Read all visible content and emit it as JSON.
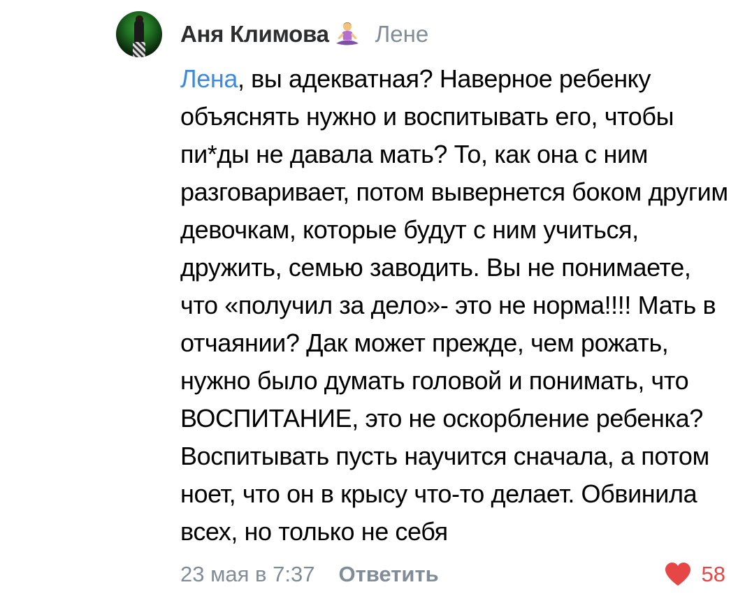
{
  "comment": {
    "author": {
      "name": "Аня Климова",
      "badge_icon": "person-in-lotus-position-icon"
    },
    "reply_to": "Лене",
    "mention": "Лена",
    "text": ", вы адекватная? Наверное ребенку объяснять нужно и воспитывать его, чтобы пи*ды не давала мать? То, как она с ним разговаривает, потом вывернется боком другим девочкам, которые будут с ним учиться, дружить, семью заводить. Вы не понимаете, что «получил за дело»- это не норма!!!! Мать в отчаянии? Дак может прежде, чем рожать,  нужно было думать головой и понимать, что ВОСПИТАНИЕ, это не оскорбление ребенка? Воспитывать пусть научится сначала, а потом ноет, что он в крысу что-то делает. Обвинила всех, но только не себя",
    "timestamp": "23 мая в 7:37",
    "reply_label": "Ответить",
    "likes": {
      "icon": "heart-icon",
      "count": "58",
      "color": "#e64646"
    }
  },
  "colors": {
    "mention": "#3f8ae0",
    "secondary_text": "#818c99",
    "author_name": "#2c2d2e"
  }
}
